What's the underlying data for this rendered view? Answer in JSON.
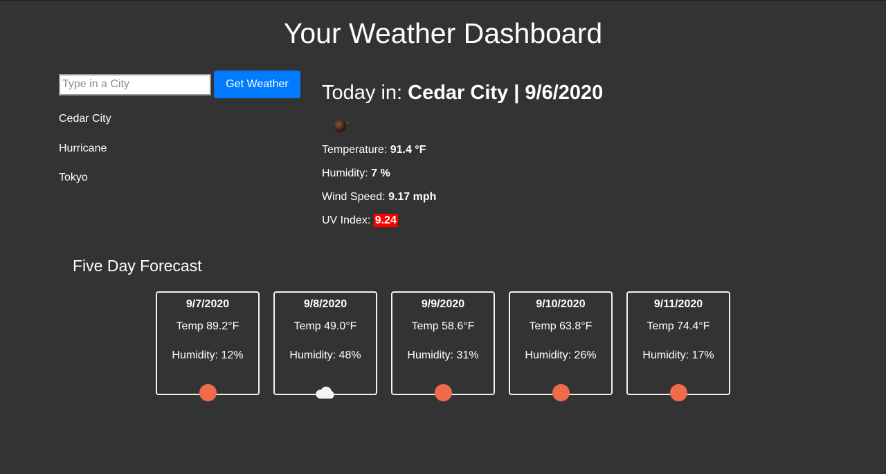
{
  "header": {
    "title": "Your Weather Dashboard"
  },
  "search": {
    "placeholder": "Type in a City",
    "value": "",
    "button_label": "Get Weather"
  },
  "history": [
    {
      "city": "Cedar City"
    },
    {
      "city": "Hurricane"
    },
    {
      "city": "Tokyo"
    }
  ],
  "today": {
    "prefix": "Today in: ",
    "city_date": "Cedar City | 9/6/2020",
    "icon": "sun-icon",
    "temperature_label": "Temperature: ",
    "temperature_value": "91.4 °F",
    "humidity_label": "Humidity: ",
    "humidity_value": "7 %",
    "wind_label": "Wind Speed: ",
    "wind_value": "9.17 mph",
    "uv_label": "UV Index: ",
    "uv_value": "9.24",
    "uv_color": "#ff0000"
  },
  "forecast": {
    "title": "Five Day Forecast",
    "days": [
      {
        "date": "9/7/2020",
        "temp": "Temp 89.2°F",
        "humidity": "Humidity: 12%",
        "icon": "sun-icon"
      },
      {
        "date": "9/8/2020",
        "temp": "Temp 49.0°F",
        "humidity": "Humidity: 48%",
        "icon": "cloud-icon"
      },
      {
        "date": "9/9/2020",
        "temp": "Temp 58.6°F",
        "humidity": "Humidity: 31%",
        "icon": "sun-icon"
      },
      {
        "date": "9/10/2020",
        "temp": "Temp 63.8°F",
        "humidity": "Humidity: 26%",
        "icon": "sun-icon"
      },
      {
        "date": "9/11/2020",
        "temp": "Temp 74.4°F",
        "humidity": "Humidity: 17%",
        "icon": "sun-icon"
      }
    ]
  },
  "colors": {
    "background": "#333333",
    "button": "#007bff",
    "sun": "#ef6b4a",
    "uv_high": "#ff0000"
  }
}
